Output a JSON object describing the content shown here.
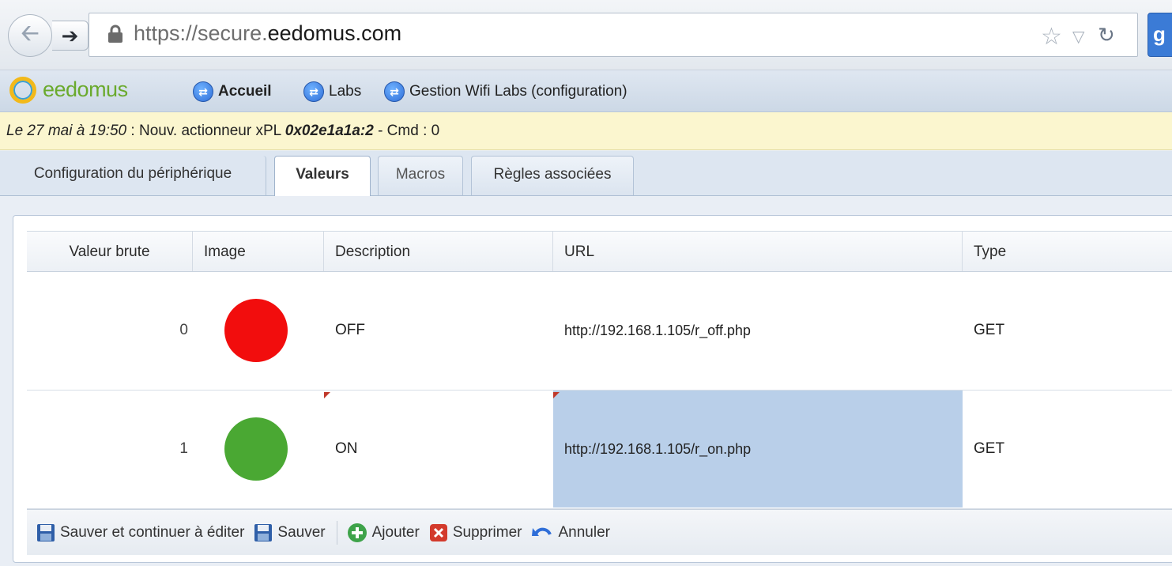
{
  "browser": {
    "url_prefix": "https://secure.",
    "url_domain": "eedomus.com"
  },
  "header": {
    "logo_text": "eedomus",
    "breadcrumbs": [
      {
        "label": "Accueil"
      },
      {
        "label": "Labs"
      },
      {
        "label": "Gestion Wifi Labs (configuration)"
      }
    ]
  },
  "notification": {
    "date": "Le 27 mai à 19:50",
    "separator": " : ",
    "text": "Nouv. actionneur xPL ",
    "address": "0x02e1a1a:2",
    "suffix": " - Cmd : 0"
  },
  "tabs": [
    {
      "label": "Configuration du périphérique",
      "active": false
    },
    {
      "label": "Valeurs",
      "active": true
    },
    {
      "label": "Macros",
      "active": false
    },
    {
      "label": "Règles associées",
      "active": false
    }
  ],
  "grid": {
    "columns": [
      "Valeur brute",
      "Image",
      "Description",
      "URL",
      "Type"
    ],
    "rows": [
      {
        "raw": "0",
        "image_color": "#f20d0d",
        "description": "OFF",
        "url": "http://192.168.1.105/r_off.php",
        "type": "GET"
      },
      {
        "raw": "1",
        "image_color": "#4aa833",
        "description": "ON",
        "url": "http://192.168.1.105/r_on.php",
        "type": "GET"
      }
    ]
  },
  "toolbar": {
    "save_continue": "Sauver et continuer à éditer",
    "save": "Sauver",
    "add": "Ajouter",
    "delete": "Supprimer",
    "cancel": "Annuler"
  }
}
